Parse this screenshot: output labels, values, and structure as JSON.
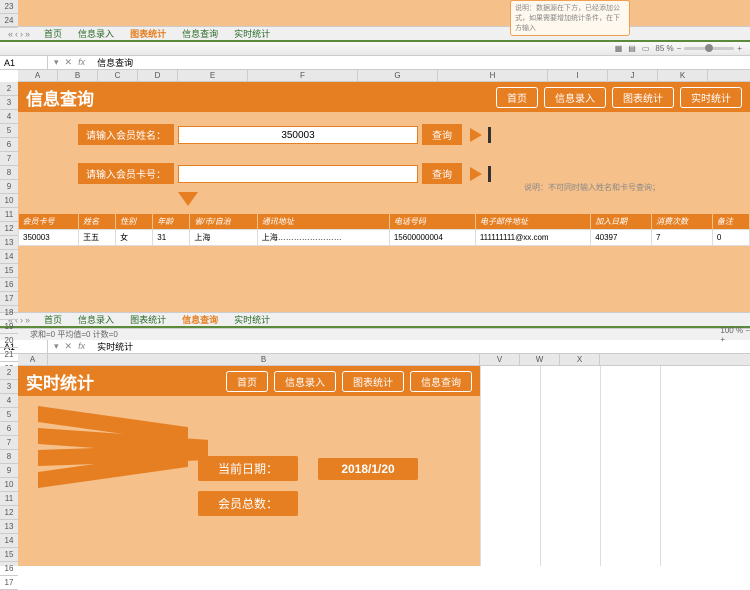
{
  "callout_top": "说明：数据源在下方，已经添加公式，如果需要增加统计条件，在下方输入",
  "section1": {
    "tabs": [
      "首页",
      "信息录入",
      "图表统计",
      "信息查询",
      "实时统计"
    ],
    "active_tab": 2,
    "zoom": "85 %",
    "cellref": "A1",
    "fx_content": "信息查询",
    "cols": [
      "A",
      "B",
      "C",
      "D",
      "E",
      "F",
      "G",
      "H",
      "I",
      "J",
      "K"
    ],
    "rowstart": 23,
    "title": "信息查询",
    "navbtns": [
      "首页",
      "信息录入",
      "图表统计",
      "实时统计"
    ],
    "search1": {
      "label": "请输入会员姓名：",
      "value": "350003",
      "btn": "查询"
    },
    "search2": {
      "label": "请输入会员卡号：",
      "value": "",
      "btn": "查询"
    },
    "note": "说明：不可同时输入姓名和卡号查询；",
    "table": {
      "headers": [
        "会员卡号",
        "姓名",
        "性别",
        "年龄",
        "省/市/自治",
        "通讯地址",
        "电话号码",
        "电子邮件地址",
        "加入日期",
        "消费次数",
        "备注"
      ],
      "row": [
        "350003",
        "王五",
        "女",
        "31",
        "上海",
        "上海……………………",
        "15600000004",
        "111111111@xx.com",
        "40397",
        "7",
        "0"
      ]
    }
  },
  "section2": {
    "tabs": [
      "首页",
      "信息录入",
      "图表统计",
      "信息查询",
      "实时统计"
    ],
    "active_tab": 3,
    "zoom": "100 %",
    "status": "求和=0  平均值=0  计数=0",
    "cellref": "A1",
    "fx_content": "实时统计",
    "cols": [
      "A",
      "B",
      "V",
      "W",
      "X"
    ],
    "title": "实时统计",
    "navbtns": [
      "首页",
      "信息录入",
      "图表统计",
      "信息查询"
    ],
    "stat_label": "当前日期：",
    "stat_value": "2018/1/20",
    "stat_label2": "会员总数："
  }
}
